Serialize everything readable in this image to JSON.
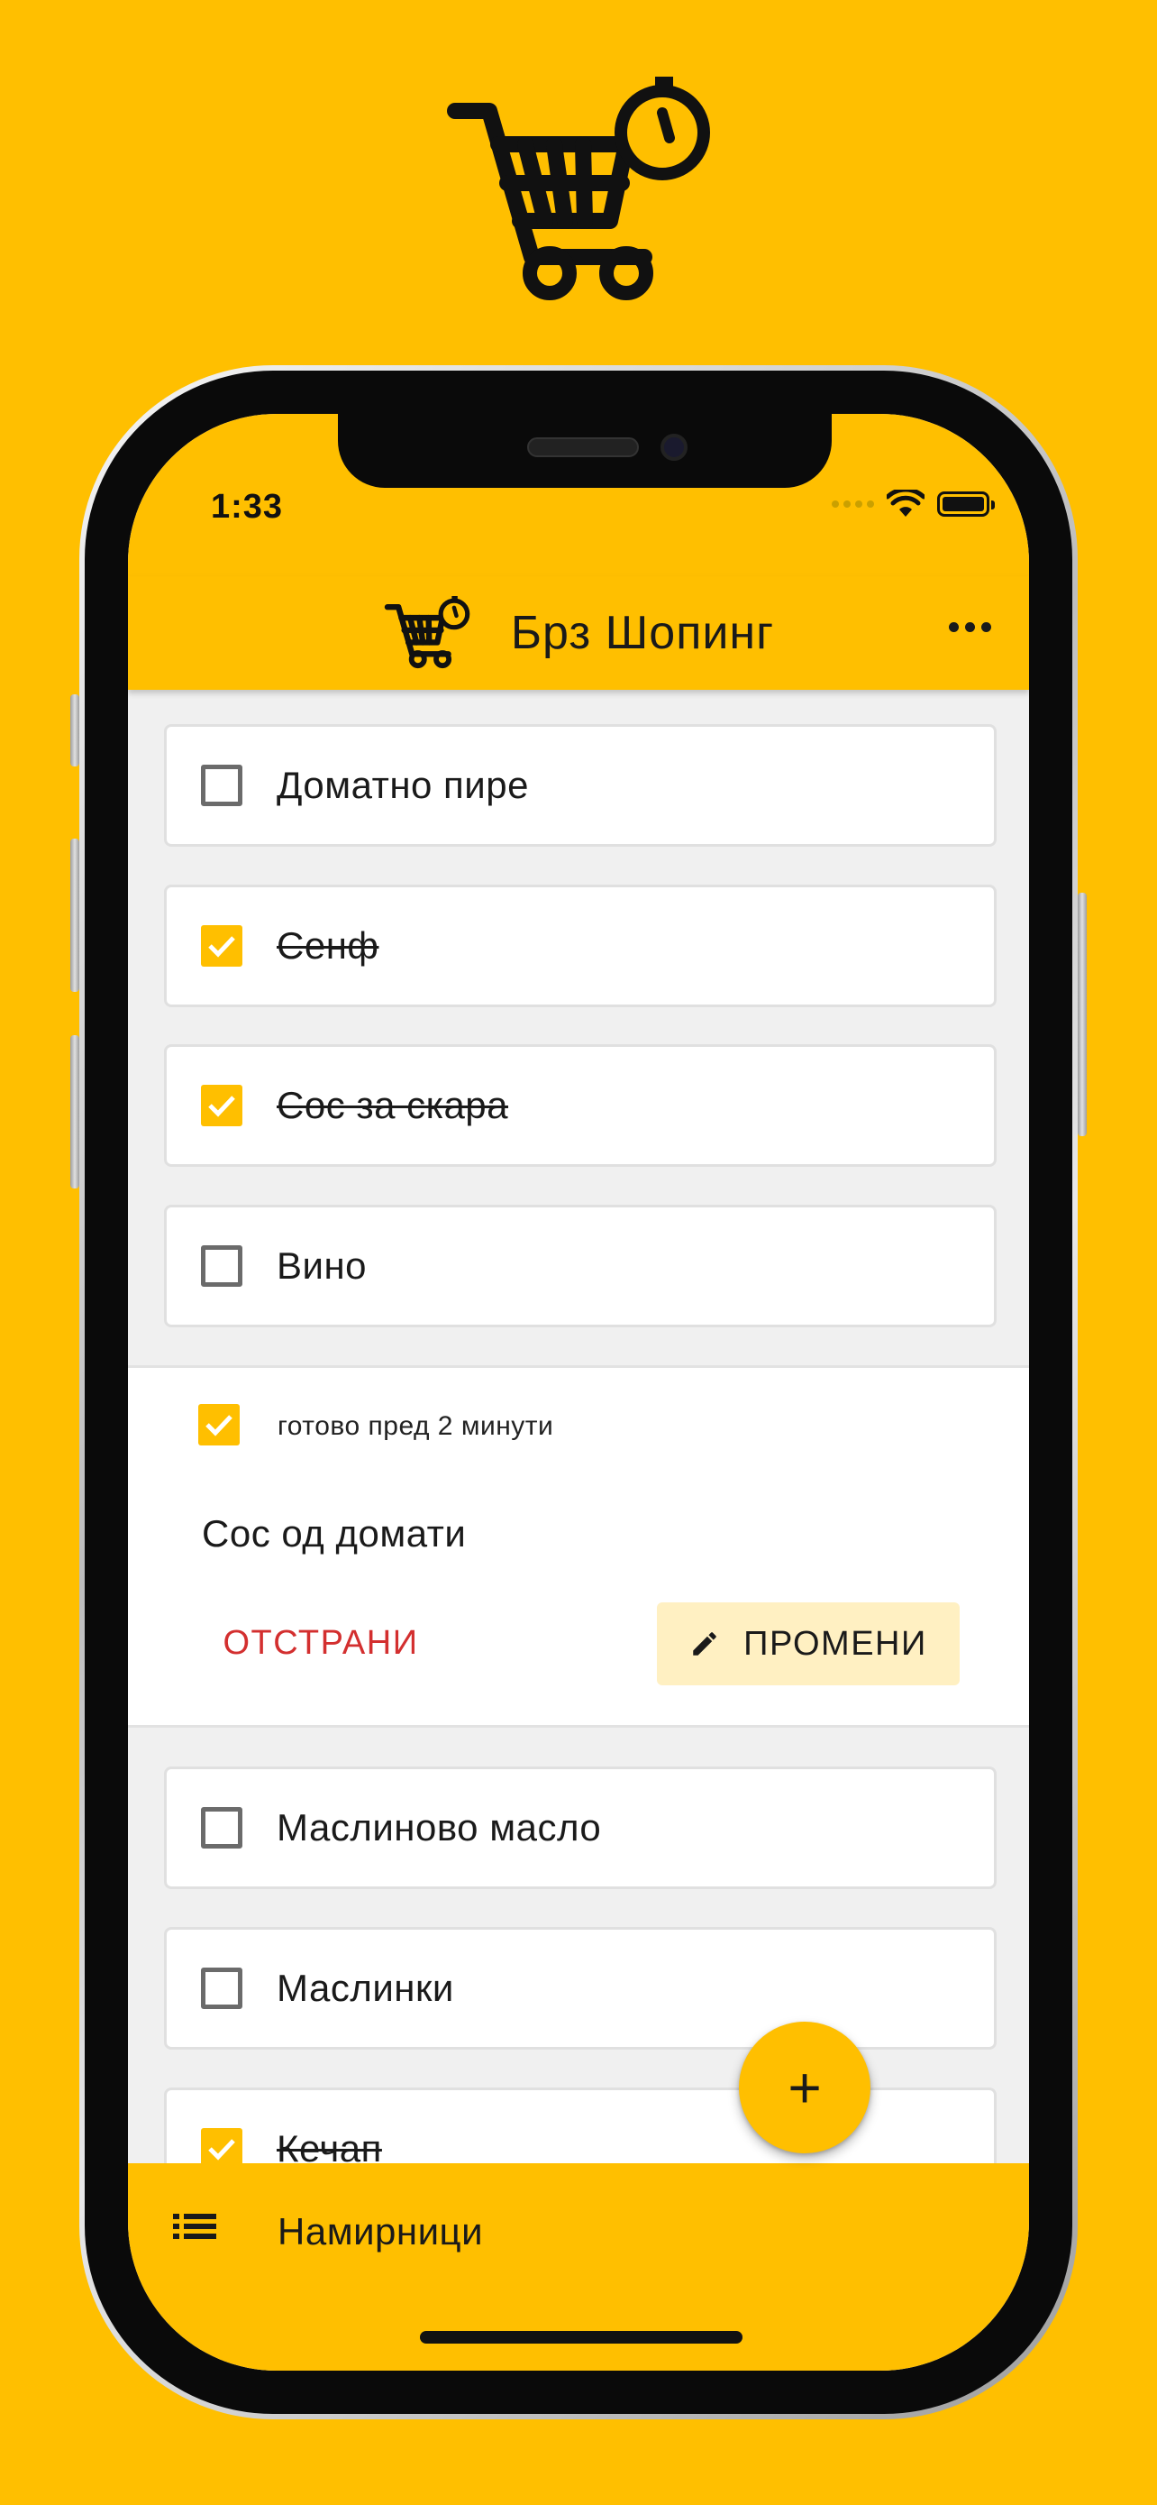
{
  "status_bar": {
    "time": "1:33"
  },
  "app_bar": {
    "title": "Брз Шопинг"
  },
  "items_before": [
    {
      "label": "Доматно пире",
      "checked": false
    },
    {
      "label": "Сенф",
      "checked": true
    },
    {
      "label": "Сос за скара",
      "checked": true
    },
    {
      "label": "Вино",
      "checked": false
    }
  ],
  "expanded_item": {
    "checked": true,
    "timestamp": "готово пред 2 минути",
    "name": "Сос од домати",
    "remove_label": "ОТСТРАНИ",
    "edit_label": "ПРОМЕНИ"
  },
  "items_after": [
    {
      "label": "Маслиново масло",
      "checked": false
    },
    {
      "label": "Маслинки",
      "checked": false
    },
    {
      "label": "Кечап",
      "checked": true
    }
  ],
  "bottom_bar": {
    "label": "Намирници"
  },
  "fab": {
    "label": "+"
  },
  "colors": {
    "accent": "#FFBF00",
    "danger": "#D32F2F",
    "edit_bg": "#FFF0C2",
    "background": "#F0F0F0"
  },
  "icons": [
    "shopping-cart-timer-logo",
    "more-horiz-icon",
    "checkbox-icon",
    "checkmark-icon",
    "pencil-icon",
    "list-icon",
    "plus-icon",
    "wifi-icon",
    "battery-icon"
  ]
}
